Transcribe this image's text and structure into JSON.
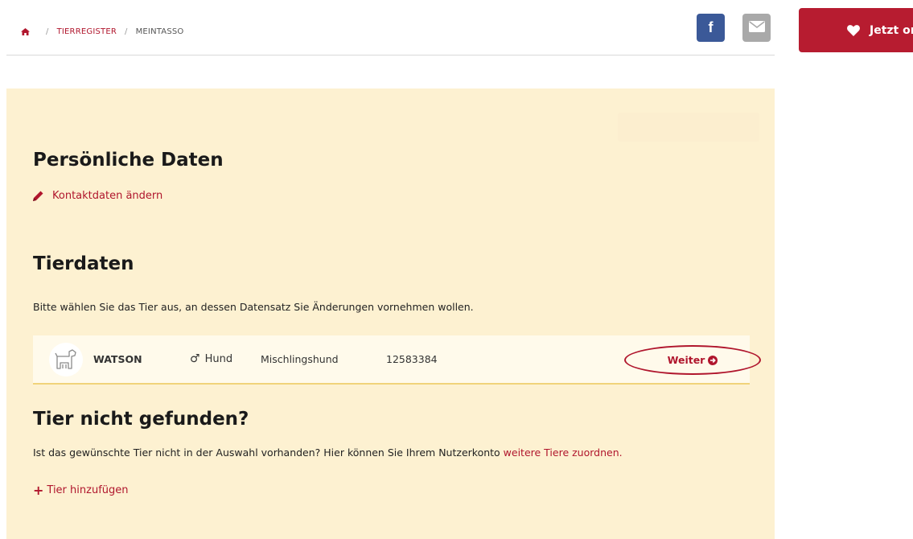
{
  "breadcrumb": {
    "home_icon": "home-icon",
    "items": [
      "TIERREGISTER",
      "MEINTASSO"
    ],
    "separator": "/"
  },
  "share": {
    "facebook_glyph": "f",
    "mail_icon": "envelope-icon"
  },
  "donate": {
    "label": "Jetzt on",
    "icon": "heart-icon"
  },
  "personal": {
    "heading": "Persönliche Daten",
    "edit_label": "Kontaktdaten ändern",
    "edit_icon": "pencil-icon"
  },
  "animals": {
    "heading": "Tierdaten",
    "intro": "Bitte wählen Sie das Tier aus, an dessen Datensatz Sie Änderungen vornehmen wollen.",
    "rows": [
      {
        "name": "WATSON",
        "sex_symbol": "♂",
        "species": "Hund",
        "breed": "Mischlingshund",
        "chip": "12583384",
        "action": "Weiter"
      }
    ]
  },
  "not_found": {
    "heading": "Tier nicht gefunden?",
    "text": "Ist das gewünschte Tier nicht in der Auswahl vorhanden? Hier können Sie Ihrem Nutzerkonto ",
    "link": "weitere Tiere zuordnen.",
    "add_label": "Tier hinzufügen"
  },
  "colors": {
    "brand_red": "#b0162d",
    "panel_bg": "#fdf1d1",
    "facebook": "#3b5998",
    "mail": "#a9a9a9"
  }
}
